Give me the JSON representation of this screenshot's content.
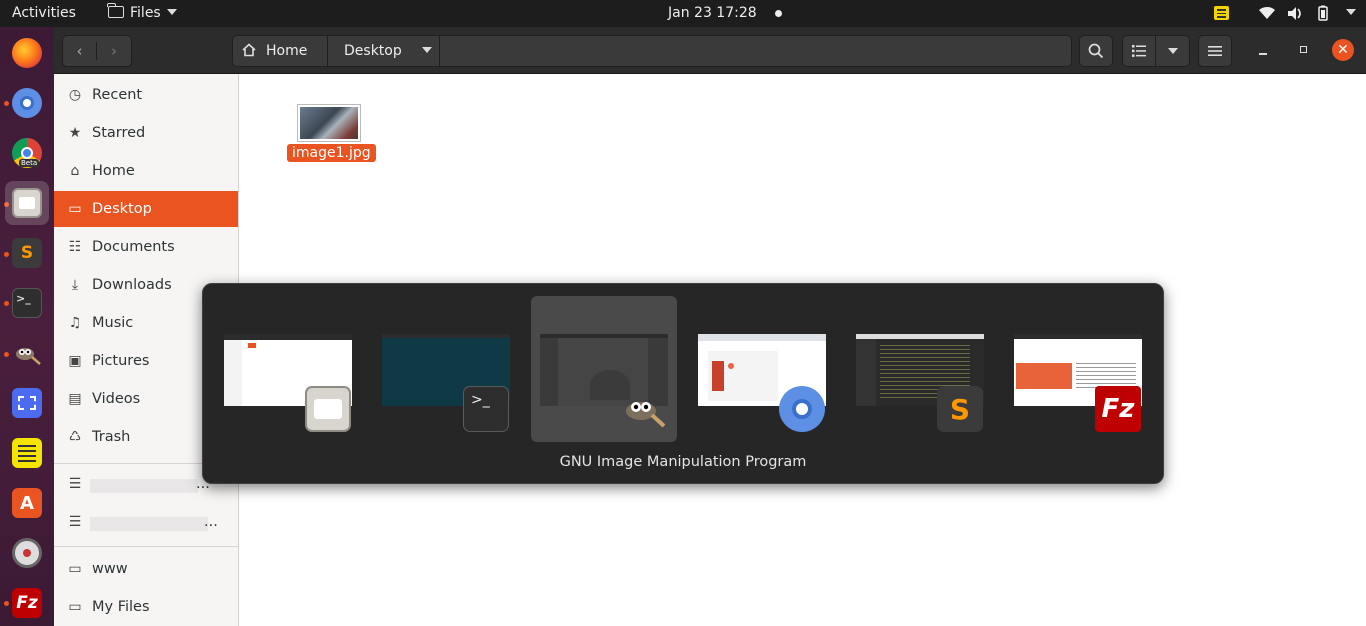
{
  "topbar": {
    "activities": "Activities",
    "app_menu": "Files",
    "clock": "Jan 23  17:28"
  },
  "dock": {
    "apps": [
      "firefox",
      "chromium",
      "chrome-beta",
      "files",
      "sublime-text",
      "terminal",
      "gimp",
      "screenshot",
      "notes",
      "software-center",
      "settings",
      "filezilla"
    ],
    "chrome_beta_badge": "Beta"
  },
  "header": {
    "breadcrumbs": [
      "Home",
      "Desktop"
    ]
  },
  "sidebar": {
    "places": [
      {
        "label": "Recent",
        "icon": "clock-icon"
      },
      {
        "label": "Starred",
        "icon": "star-icon"
      },
      {
        "label": "Home",
        "icon": "home-icon"
      },
      {
        "label": "Desktop",
        "icon": "desktop-icon",
        "selected": true
      },
      {
        "label": "Documents",
        "icon": "document-icon"
      },
      {
        "label": "Downloads",
        "icon": "download-icon"
      },
      {
        "label": "Music",
        "icon": "music-icon"
      },
      {
        "label": "Pictures",
        "icon": "pictures-icon"
      },
      {
        "label": "Videos",
        "icon": "video-icon"
      },
      {
        "label": "Trash",
        "icon": "trash-icon"
      }
    ],
    "servers": [
      "...",
      "..."
    ],
    "bookmarks": [
      "www",
      "My Files"
    ]
  },
  "files": [
    {
      "name": "image1.jpg",
      "selected": true
    }
  ],
  "switcher": {
    "apps": [
      "Files",
      "Terminal",
      "GNU Image Manipulation Program",
      "Chromium",
      "Sublime Text",
      "FileZilla"
    ],
    "selected_label": "GNU Image Manipulation Program"
  },
  "colors": {
    "accent": "#e95420",
    "topbar": "#1d1d1d",
    "header": "#2c2c2c",
    "sidebar": "#f6f5f4",
    "switcher_bg": "#262626"
  }
}
